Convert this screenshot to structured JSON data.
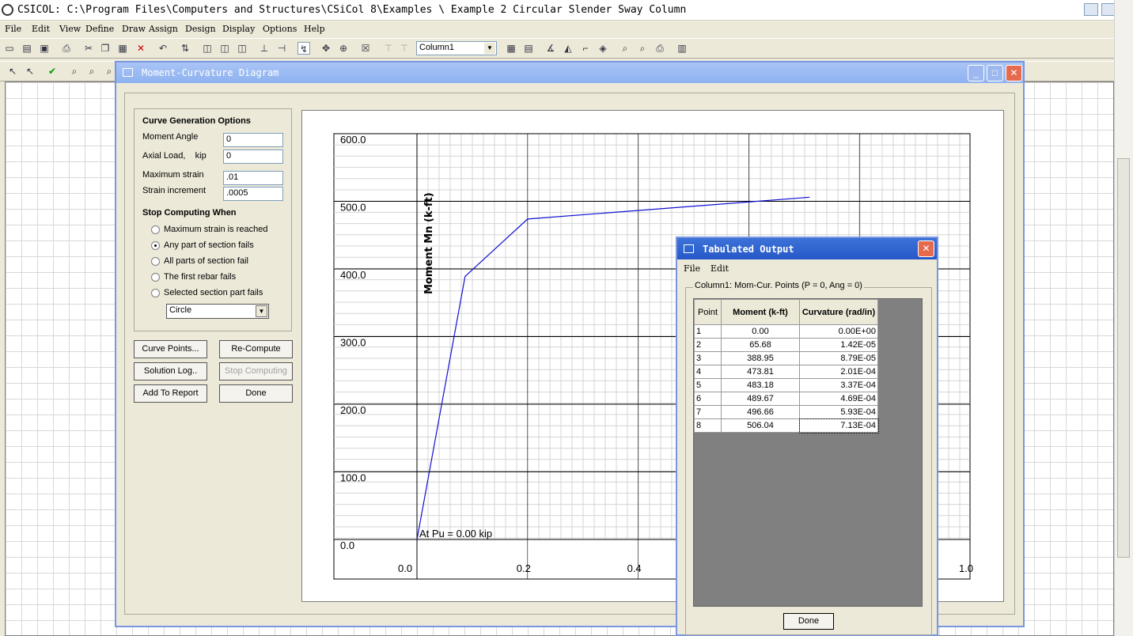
{
  "app": {
    "title": "CSICOL: C:\\Program Files\\Computers and Structures\\CSiCol 8\\Examples \\ Example 2 Circular Slender Sway Column"
  },
  "menu": [
    "File",
    "Edit",
    "View",
    "Define",
    "Draw",
    "Assign",
    "Design",
    "Display",
    "Options",
    "Help"
  ],
  "toolbar": {
    "column_select": "Column1"
  },
  "mc_window": {
    "title": "Moment-Curvature Diagram",
    "options": {
      "heading": "Curve Generation Options",
      "moment_angle_label": "Moment Angle",
      "moment_angle": "0",
      "axial_load_label": "Axial Load,    kip",
      "axial_load": "0",
      "max_strain_label": "Maximum strain",
      "max_strain": ".01",
      "strain_inc_label": "Strain increment",
      "strain_inc": ".0005",
      "stop_heading": "Stop Computing When",
      "stop_options": [
        "Maximum strain is reached",
        "Any part of section fails",
        "All parts of section fail",
        "The first rebar fails",
        "Selected section part fails"
      ],
      "selected_index": 1,
      "section_part": "Circle"
    },
    "buttons": {
      "curve_points": "Curve Points...",
      "recompute": "Re-Compute",
      "solution_log": "Solution Log..",
      "stop_computing": "Stop Computing",
      "add_to_report": "Add To Report",
      "done": "Done"
    }
  },
  "chart_data": {
    "type": "line",
    "ylabel": "Moment Mn (k-ft)",
    "xlabel": "",
    "annotation": "At Pu = 0.00 kip",
    "ylim": [
      0,
      600
    ],
    "xlim": [
      0,
      1.0
    ],
    "y_ticks": [
      "600.0",
      "500.0",
      "400.0",
      "300.0",
      "200.0",
      "100.0",
      "0.0"
    ],
    "x_ticks": [
      "0.0",
      "0.2",
      "0.4",
      "1.0"
    ],
    "series": [
      {
        "x": [
          0,
          0.087,
          0.2,
          0.71
        ],
        "values": [
          0,
          388.95,
          473.81,
          506.04
        ]
      }
    ]
  },
  "tab_window": {
    "title": "Tabulated Output",
    "menu": [
      "File",
      "Edit"
    ],
    "group_label": "Column1: Mom-Cur. Points (P = 0, Ang = 0)",
    "headers": [
      "Point",
      "Moment  (k-ft)",
      "Curvature (rad/in)"
    ],
    "rows": [
      [
        "1",
        "0.00",
        "0.00E+00"
      ],
      [
        "2",
        "65.68",
        "1.42E-05"
      ],
      [
        "3",
        "388.95",
        "8.79E-05"
      ],
      [
        "4",
        "473.81",
        "2.01E-04"
      ],
      [
        "5",
        "483.18",
        "3.37E-04"
      ],
      [
        "6",
        "489.67",
        "4.69E-04"
      ],
      [
        "7",
        "496.66",
        "5.93E-04"
      ],
      [
        "8",
        "506.04",
        "7.13E-04"
      ]
    ],
    "done": "Done"
  }
}
